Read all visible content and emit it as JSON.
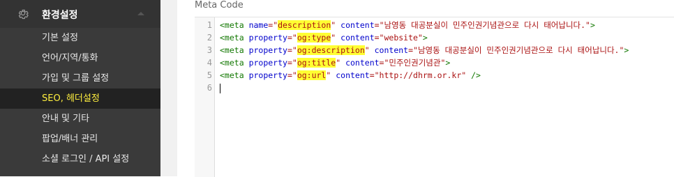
{
  "sidebar": {
    "section_title": "환경설정",
    "items": [
      {
        "label": "기본 설정",
        "active": false
      },
      {
        "label": "언어/지역/통화",
        "active": false
      },
      {
        "label": "가입 및 그룹 설정",
        "active": false
      },
      {
        "label": "SEO, 헤더설정",
        "active": true
      },
      {
        "label": "안내 및 기타",
        "active": false
      },
      {
        "label": "팝업/배너 관리",
        "active": false
      },
      {
        "label": "소셜 로그인 / API 설정",
        "active": false
      }
    ]
  },
  "panel": {
    "title": "Meta Code"
  },
  "editor": {
    "line_numbers": [
      "1",
      "2",
      "3",
      "4",
      "5",
      "6"
    ],
    "lines": [
      [
        {
          "t": "<meta",
          "c": "tag"
        },
        {
          "t": " ",
          "c": ""
        },
        {
          "t": "name",
          "c": "attr"
        },
        {
          "t": "=\"",
          "c": "str"
        },
        {
          "t": "description",
          "c": "str",
          "hl": true
        },
        {
          "t": "\"",
          "c": "str"
        },
        {
          "t": " ",
          "c": ""
        },
        {
          "t": "content",
          "c": "attr"
        },
        {
          "t": "=\"남영동 대공분실이 민주인권기념관으로 다시 태어납니다.\"",
          "c": "str"
        },
        {
          "t": ">",
          "c": "tag"
        }
      ],
      [
        {
          "t": "<meta",
          "c": "tag"
        },
        {
          "t": " ",
          "c": ""
        },
        {
          "t": "property",
          "c": "attr"
        },
        {
          "t": "=\"",
          "c": "str"
        },
        {
          "t": "og:type",
          "c": "str",
          "hl": true
        },
        {
          "t": "\"",
          "c": "str"
        },
        {
          "t": " ",
          "c": ""
        },
        {
          "t": "content",
          "c": "attr"
        },
        {
          "t": "=\"website\"",
          "c": "str"
        },
        {
          "t": ">",
          "c": "tag"
        }
      ],
      [
        {
          "t": "<meta",
          "c": "tag"
        },
        {
          "t": " ",
          "c": ""
        },
        {
          "t": "property",
          "c": "attr"
        },
        {
          "t": "=\"",
          "c": "str"
        },
        {
          "t": "og:description",
          "c": "str",
          "hl": true
        },
        {
          "t": "\"",
          "c": "str"
        },
        {
          "t": " ",
          "c": ""
        },
        {
          "t": "content",
          "c": "attr"
        },
        {
          "t": "=\"남영동 대공분실이 민주인권기념관으로 다시 태어납니다.\"",
          "c": "str"
        },
        {
          "t": ">",
          "c": "tag"
        }
      ],
      [
        {
          "t": "<meta",
          "c": "tag"
        },
        {
          "t": " ",
          "c": ""
        },
        {
          "t": "property",
          "c": "attr"
        },
        {
          "t": "=\"",
          "c": "str"
        },
        {
          "t": "og:title",
          "c": "str",
          "hl": true
        },
        {
          "t": "\"",
          "c": "str"
        },
        {
          "t": " ",
          "c": ""
        },
        {
          "t": "content",
          "c": "attr"
        },
        {
          "t": "=\"민주인권기념관\"",
          "c": "str"
        },
        {
          "t": ">",
          "c": "tag"
        }
      ],
      [
        {
          "t": "<meta",
          "c": "tag"
        },
        {
          "t": " ",
          "c": ""
        },
        {
          "t": "property",
          "c": "attr"
        },
        {
          "t": "=\"",
          "c": "str"
        },
        {
          "t": "og:url",
          "c": "str",
          "hl": true
        },
        {
          "t": "\"",
          "c": "str"
        },
        {
          "t": " ",
          "c": ""
        },
        {
          "t": "content",
          "c": "attr"
        },
        {
          "t": "=\"http://dhrm.or.kr\"",
          "c": "str"
        },
        {
          "t": " />",
          "c": "tag"
        }
      ],
      []
    ]
  },
  "colors": {
    "sidebar_bg": "#3a3a3a",
    "active_item_bg": "#222222",
    "active_item_text": "#ffef3f",
    "highlight": "#ffff33",
    "tag_color": "#117700",
    "attr_color": "#0000cc",
    "string_color": "#aa1111"
  },
  "icons": {
    "section": "gear-icon",
    "collapse": "caret-up-icon"
  }
}
